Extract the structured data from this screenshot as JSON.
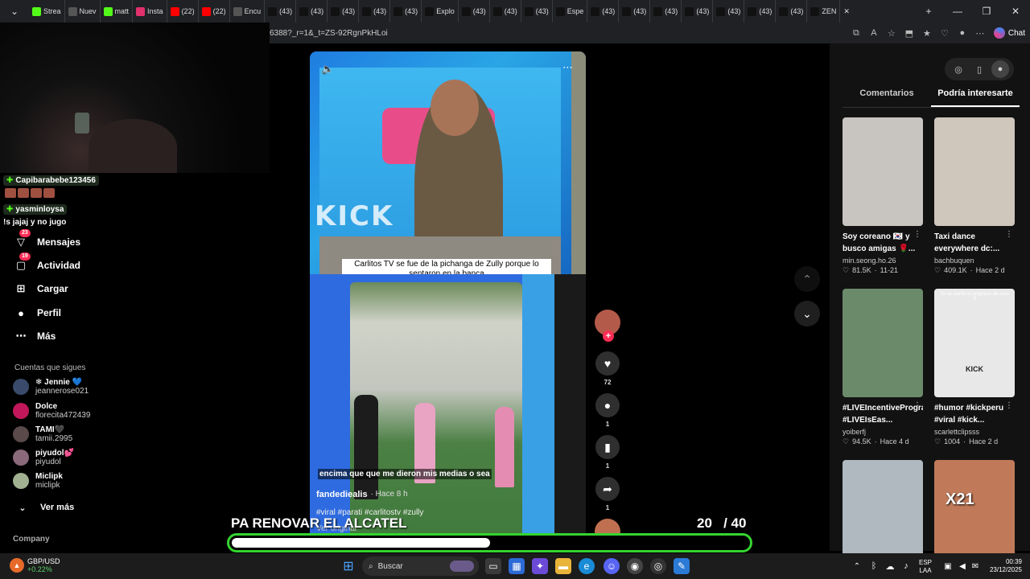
{
  "browser": {
    "tabs": [
      {
        "label": "Strea",
        "icon": "kick-icon",
        "color": "#53fc18"
      },
      {
        "label": "Nuev",
        "icon": "page-icon",
        "color": "#555555"
      },
      {
        "label": "matt",
        "icon": "kick-icon",
        "color": "#53fc18"
      },
      {
        "label": "Insta",
        "icon": "instagram-icon",
        "color": "#e1306c"
      },
      {
        "label": "(22)",
        "icon": "youtube-icon",
        "color": "#ff0000"
      },
      {
        "label": "(22)",
        "icon": "youtube-icon",
        "color": "#ff0000"
      },
      {
        "label": "Encu",
        "icon": "page-icon",
        "color": "#555555"
      },
      {
        "label": "(43)",
        "icon": "tiktok-icon",
        "color": "#111111"
      },
      {
        "label": "(43)",
        "icon": "tiktok-icon",
        "color": "#111111"
      },
      {
        "label": "(43)",
        "icon": "tiktok-icon",
        "color": "#111111"
      },
      {
        "label": "(43)",
        "icon": "tiktok-icon",
        "color": "#111111"
      },
      {
        "label": "(43)",
        "icon": "tiktok-icon",
        "color": "#111111"
      },
      {
        "label": "Explo",
        "icon": "tiktok-icon",
        "color": "#111111"
      },
      {
        "label": "(43)",
        "icon": "tiktok-icon",
        "color": "#111111"
      },
      {
        "label": "(43)",
        "icon": "tiktok-icon",
        "color": "#111111"
      },
      {
        "label": "(43)",
        "icon": "tiktok-icon",
        "color": "#111111"
      },
      {
        "label": "Espe",
        "icon": "tiktok-icon",
        "color": "#111111"
      },
      {
        "label": "(43)",
        "icon": "tiktok-icon",
        "color": "#111111"
      },
      {
        "label": "(43)",
        "icon": "tiktok-icon",
        "color": "#111111"
      },
      {
        "label": "(43)",
        "icon": "tiktok-icon",
        "color": "#111111"
      },
      {
        "label": "(43)",
        "icon": "tiktok-icon",
        "color": "#111111"
      },
      {
        "label": "(43)",
        "icon": "tiktok-icon",
        "color": "#111111"
      },
      {
        "label": "(43)",
        "icon": "tiktok-icon",
        "color": "#111111"
      },
      {
        "label": "(43)",
        "icon": "tiktok-icon",
        "color": "#111111"
      },
      {
        "label": "ZEN",
        "icon": "tiktok-icon",
        "color": "#111111"
      }
    ],
    "url": "6388?_r=1&_t=ZS-92RgnPkHLoi",
    "chat_label": "Chat"
  },
  "stream_chat": {
    "user1": "Capibarabebe123456",
    "user2": "yasminloysa",
    "message": "!s jajaj y no jugo"
  },
  "sidebar": {
    "nav": [
      {
        "label": "Mensajes",
        "icon": "paper-plane-icon",
        "badge": "23"
      },
      {
        "label": "Actividad",
        "icon": "activity-icon",
        "badge": "19"
      },
      {
        "label": "Cargar",
        "icon": "upload-icon",
        "badge": ""
      },
      {
        "label": "Perfil",
        "icon": "profile-icon",
        "badge": ""
      },
      {
        "label": "Más",
        "icon": "more-icon",
        "badge": ""
      }
    ],
    "following_title": "Cuentas que sigues",
    "following": [
      {
        "name": "❄ Jennie 💙",
        "handle": "jeannerose021",
        "color": "#3a4a6a"
      },
      {
        "name": "Dolce",
        "handle": "florecita472439",
        "color": "#c2185b"
      },
      {
        "name": "TAMI🖤",
        "handle": "tamii.2995",
        "color": "#5a4a4a"
      },
      {
        "name": "piyudol💕",
        "handle": "piyudol",
        "color": "#8a6a7a"
      },
      {
        "name": "Miclipk",
        "handle": "miclipk",
        "color": "#a0b090"
      }
    ],
    "see_more": "Ver más",
    "company": "Company"
  },
  "feed": {
    "video1_caption": "Carlitos TV se fue de la pichanga de Zully porque lo sentaron en la banca",
    "video1_watermark": "KICK",
    "video2_subtitle": "encima que que me dieron mis medias o sea",
    "video2_author": "fandediealis",
    "video2_time": "· Hace 8 h",
    "video2_tags": "#viral #parati #carlitostv #zully",
    "video2_more": "Ver original",
    "actions": {
      "likes": "72",
      "comments": "1",
      "saves": "1",
      "shares": "1"
    }
  },
  "right_panel": {
    "tab_comments": "Comentarios",
    "tab_interesting": "Podría interesarte",
    "cards": [
      {
        "title": "Soy coreano 🇰🇷 y busco amigas 🌹...",
        "author": "min.seong.ho.26",
        "likes": "81.5K",
        "date": "11-21",
        "bg": "#c8c4c0"
      },
      {
        "title": "Taxi dance everywhere dc:...",
        "author": "bachbuquen",
        "likes": "409.1K",
        "date": "Hace 2 d",
        "bg": "#cfc6bc"
      },
      {
        "title": "#LIVEIncentiveProgram #LIVEIsEas...",
        "author": "yoiberfj",
        "likes": "94.5K",
        "date": "Hace 4 d",
        "bg": "#6a8a6a"
      },
      {
        "title": "#humor #kickperu #viral #kick...",
        "author": "scarlettclipsss",
        "likes": "1004",
        "date": "Hace 2 d",
        "bg": "#e8e8e8"
      },
      {
        "title": "",
        "author": "",
        "likes": "",
        "date": "",
        "bg": "#b0b8c0"
      },
      {
        "title": "",
        "author": "",
        "likes": "",
        "date": "",
        "bg": "#c07a5a"
      }
    ],
    "card_top_texts": [
      "",
      "",
      "",
      "Yo se siente el progreso de euro :3",
      "",
      ""
    ],
    "card4_watermark": "KICK",
    "card6_overlay": "X21"
  },
  "overlay": {
    "title": "PA RENOVAR EL ALCATEL",
    "count": "20   / 40",
    "progress_fraction": 0.5,
    "accent": "#34d430"
  },
  "taskbar": {
    "ticker_name": "GBP/USD",
    "ticker_change": "+0.22%",
    "search_placeholder": "Buscar",
    "lang1": "ESP",
    "lang2": "LAA",
    "time": "00:39",
    "date": "23/12/2025"
  }
}
